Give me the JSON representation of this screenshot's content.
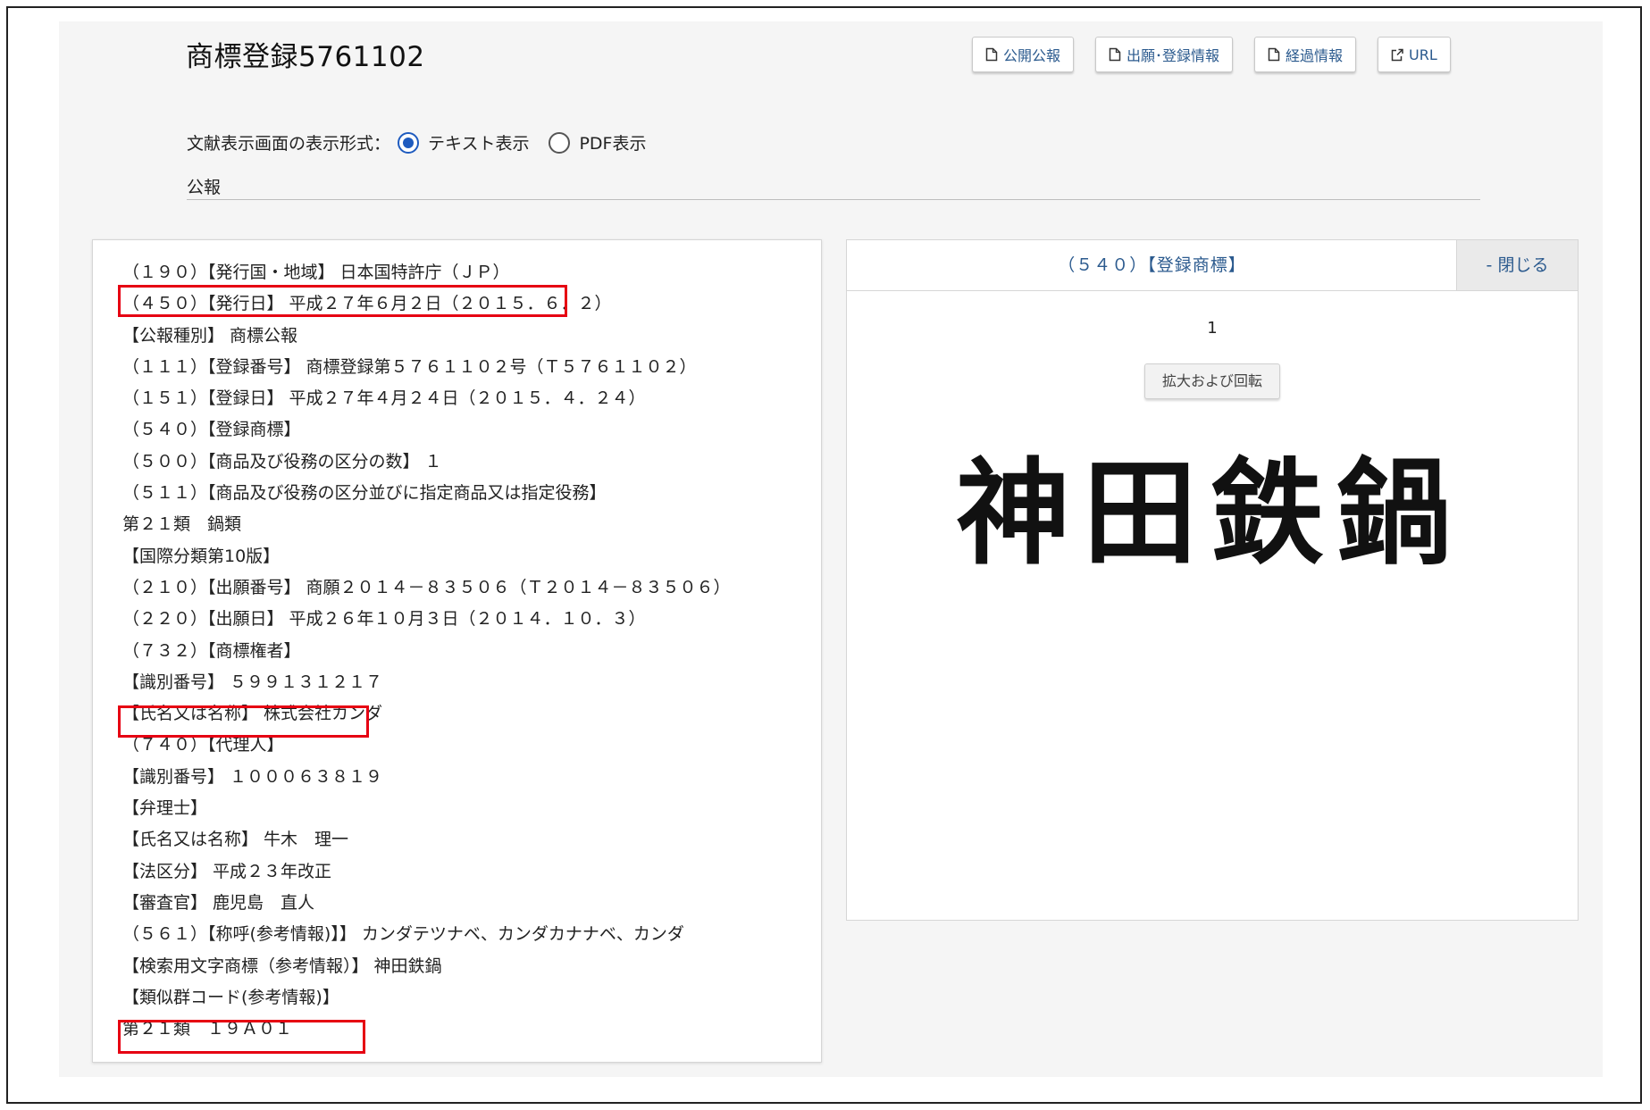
{
  "title": "商標登録5761102",
  "toolbar": [
    {
      "label": "公開公報",
      "icon": "document-icon"
    },
    {
      "label": "出願･登録情報",
      "icon": "document-icon"
    },
    {
      "label": "経過情報",
      "icon": "document-icon"
    },
    {
      "label": "URL",
      "icon": "external-link-icon"
    }
  ],
  "display_format": {
    "label": "文献表示画面の表示形式：",
    "options": [
      {
        "label": "テキスト表示",
        "selected": true
      },
      {
        "label": "PDF表示",
        "selected": false
      }
    ]
  },
  "section_label": "公報",
  "lines": [
    "（１９０）【発行国・地域】 日本国特許庁（ＪＰ）",
    "（４５０）【発行日】 平成２７年６月２日（２０１５．６．２）",
    "【公報種別】 商標公報",
    "（１１１）【登録番号】 商標登録第５７６１１０２号（Ｔ５７６１１０２）",
    "（１５１）【登録日】 平成２７年４月２４日（２０１５．４．２４）",
    "（５４０）【登録商標】",
    "（５００）【商品及び役務の区分の数】 １",
    "（５１１）【商品及び役務の区分並びに指定商品又は指定役務】",
    "第２１類　鍋類",
    "【国際分類第10版】",
    "（２１０）【出願番号】 商願２０１４－８３５０６（Ｔ２０１４－８３５０６）",
    "（２２０）【出願日】 平成２６年１０月３日（２０１４．１０．３）",
    "（７３２）【商標権者】",
    "【識別番号】 ５９９１３１２１７",
    "【氏名又は名称】 株式会社カンダ",
    "（７４０）【代理人】",
    "【識別番号】 １０００６３８１９",
    "【弁理士】",
    "【氏名又は名称】 牛木　理一",
    "【法区分】 平成２３年改正",
    "【審査官】 鹿児島　直人",
    "（５６１）【称呼(参考情報)】】 カンダテツナベ、カンダカナナベ、カンダ",
    "【検索用文字商標（参考情報）】 神田鉄鍋",
    "【類似群コード(参考情報)】",
    "第２１類　１９Ａ０１"
  ],
  "highlighted_lines": [
    1,
    14,
    24
  ],
  "highlight_color": "#e60012",
  "preview": {
    "title": "（５４０）【登録商標】",
    "close_label": "- 閉じる",
    "page_number": "1",
    "zoom_label": "拡大および回転",
    "mark_text": "神田鉄鍋"
  },
  "colors": {
    "link": "#2b5a8e",
    "radio_selected": "#1e5bbf",
    "page_background": "#f5f5f5"
  }
}
